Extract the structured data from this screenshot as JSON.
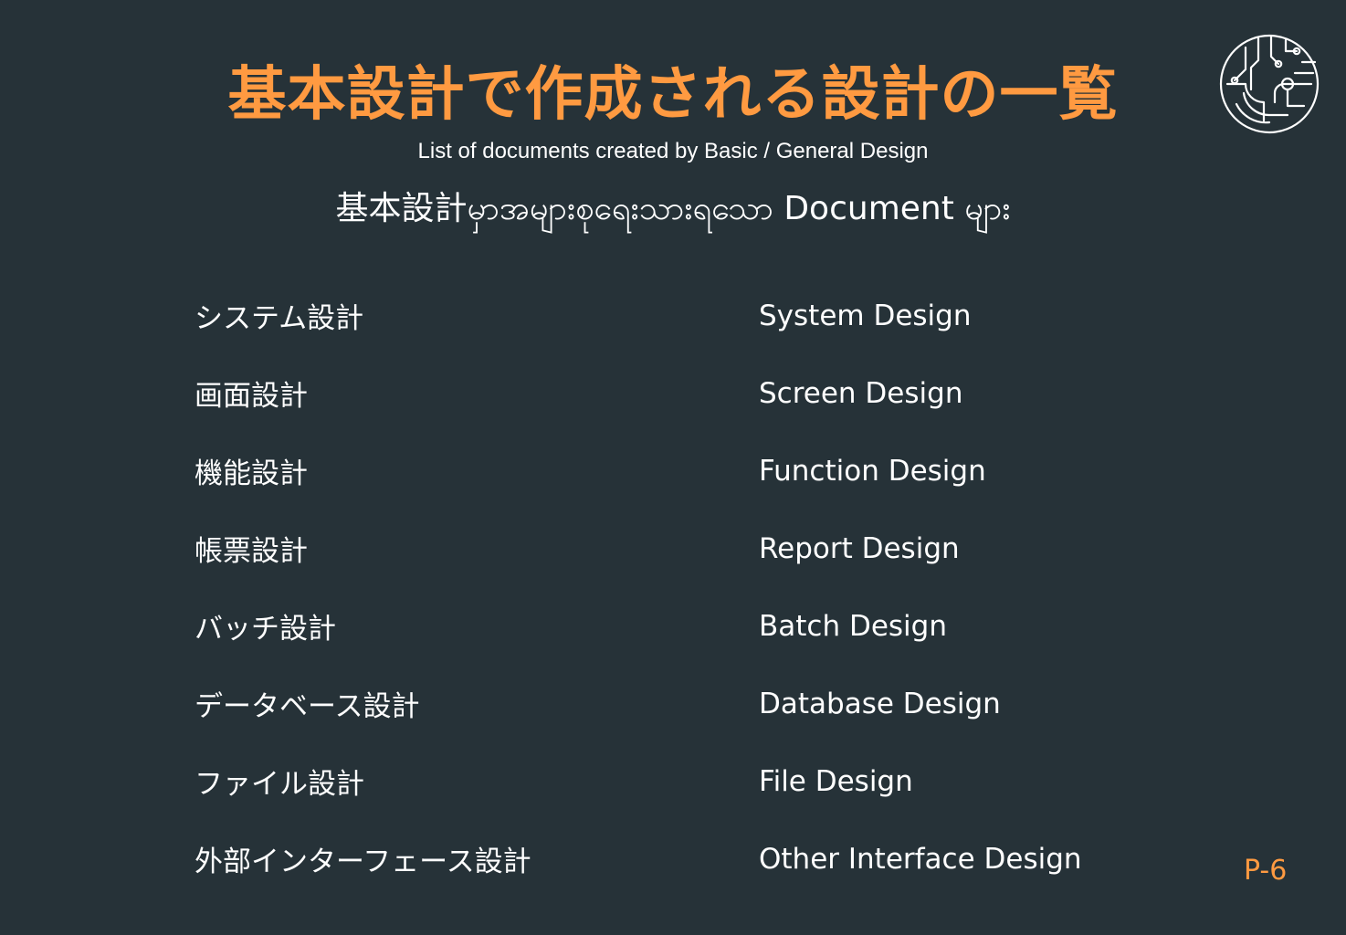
{
  "header": {
    "title": "基本設計で作成される設計の一覧",
    "subtitle_en": "List of documents created by Basic / General Design",
    "subtitle_my": "基本設計မှာအများစုရေးသားရသော Document များ"
  },
  "logo": {
    "icon": "circuit-logo-icon"
  },
  "documents": [
    {
      "jp": "システム設計",
      "en": "System Design"
    },
    {
      "jp": "画面設計",
      "en": "Screen Design"
    },
    {
      "jp": "機能設計",
      "en": "Function Design"
    },
    {
      "jp": "帳票設計",
      "en": "Report Design"
    },
    {
      "jp": "バッチ設計",
      "en": "Batch Design"
    },
    {
      "jp": "データベース設計",
      "en": "Database Design"
    },
    {
      "jp": "ファイル設計",
      "en": "File Design"
    },
    {
      "jp": "外部インターフェース設計",
      "en": "Other Interface Design"
    }
  ],
  "footer": {
    "page_number": "P-6"
  },
  "colors": {
    "background": "#263238",
    "accent": "#ff9a41",
    "text": "#ffffff"
  }
}
